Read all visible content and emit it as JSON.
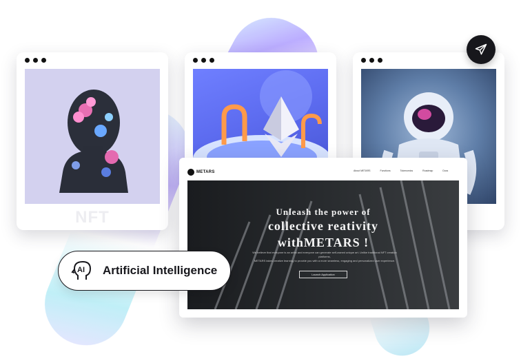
{
  "cards": [
    {
      "label": "NFT"
    }
  ],
  "site": {
    "brand": "METARS",
    "nav": [
      "About METARS",
      "Functions",
      "Tokenomics",
      "Roadmap",
      "Docs"
    ],
    "hero": {
      "line1": "Unleash the power of",
      "line2": "collective reativity",
      "line3": "withMETARS !",
      "copy1": "We believe that everyone is an artist and everyone can generate self-owned unique art. Unlike traditional NFT creation platforms,",
      "copy2": "METARS takes creative learning to provide you with a more seamless, engaging and personalized user experience.",
      "button": "Launch Application"
    }
  },
  "badge": {
    "icon_text": "AI",
    "label": "Artificial Intelligence"
  },
  "icons": {
    "send": "send-icon",
    "ai": "ai-head-icon"
  }
}
